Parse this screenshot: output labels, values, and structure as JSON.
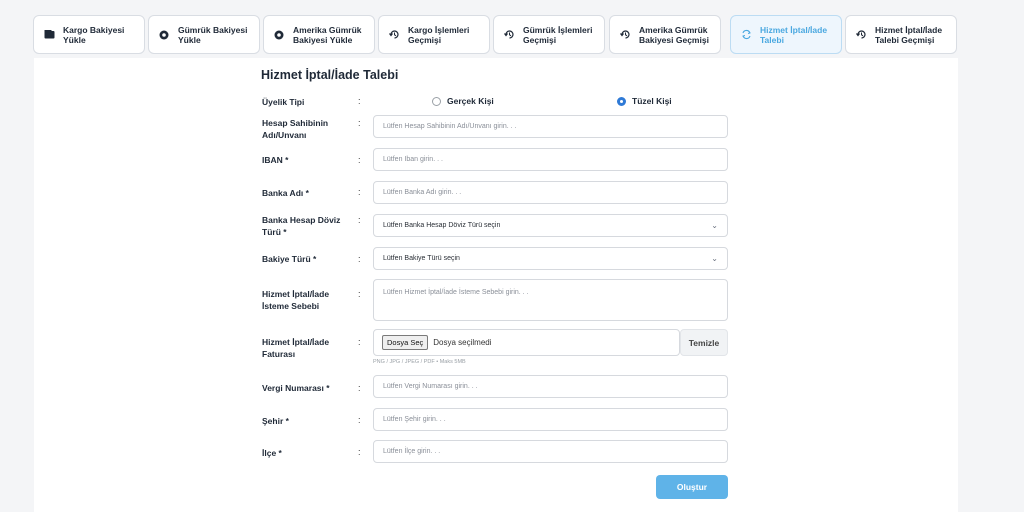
{
  "tabs": [
    {
      "label": "Kargo Bakiyesi Yükle",
      "icon": "wallet-icon",
      "active": false
    },
    {
      "label": "Gümrük Bakiyesi Yükle",
      "icon": "globe-icon",
      "active": false
    },
    {
      "label": "Amerika Gümrük Bakiyesi Yükle",
      "icon": "globe-icon",
      "active": false
    },
    {
      "label": "Kargo İşlemleri Geçmişi",
      "icon": "history-icon",
      "active": false
    },
    {
      "label": "Gümrük İşlemleri Geçmişi",
      "icon": "history-icon",
      "active": false
    },
    {
      "label": "Amerika Gümrük Bakiyesi Geçmişi",
      "icon": "history-icon",
      "active": false
    },
    {
      "label": "Hizmet İptal/İade Talebi",
      "icon": "refresh-icon",
      "active": true
    },
    {
      "label": "Hizmet İptal/İade Talebi Geçmişi",
      "icon": "history-icon",
      "active": false
    }
  ],
  "form": {
    "title": "Hizmet İptal/İade Talebi",
    "membership": {
      "label": "Üyelik Tipi",
      "option_individual": "Gerçek Kişi",
      "option_corporate": "Tüzel Kişi",
      "selected": "Tüzel Kişi"
    },
    "account_holder": {
      "label": "Hesap Sahibinin Adı/Unvanı",
      "placeholder": "Lütfen Hesap Sahibinin Adı/Unvanı girin. . ."
    },
    "iban": {
      "label": "IBAN *",
      "placeholder": "Lütfen Iban girin. . ."
    },
    "bank_name": {
      "label": "Banka Adı *",
      "placeholder": "Lütfen Banka Adı girin. . ."
    },
    "currency": {
      "label": "Banka Hesap Döviz Türü *",
      "value": "Lütfen Banka Hesap Döviz Türü seçin"
    },
    "balance_type": {
      "label": "Bakiye Türü *",
      "value": "Lütfen Bakiye Türü seçin"
    },
    "reason": {
      "label": "Hizmet İptal/İade İsteme Sebebi",
      "placeholder": "Lütfen Hizmet İptal/İade İsteme Sebebi girin. . ."
    },
    "invoice": {
      "label": "Hizmet İptal/İade Faturası",
      "choose_button": "Dosya Seç",
      "file_status": "Dosya seçilmedi",
      "clear_button": "Temizle",
      "hint": "PNG / JPG / JPEG / PDF • Maks 5MB"
    },
    "tax_number": {
      "label": "Vergi Numarası *",
      "placeholder": "Lütfen Vergi Numarası girin. . ."
    },
    "city": {
      "label": "Şehir *",
      "placeholder": "Lütfen Şehir girin. . ."
    },
    "district": {
      "label": "İlçe *",
      "placeholder": "Lütfen İlçe girin. . ."
    },
    "colon": ":",
    "submit_label": "Oluştur"
  },
  "colors": {
    "accent": "#5fb3e8",
    "active_tab_text": "#4aa8e0",
    "radio_on": "#2f7ad6"
  }
}
